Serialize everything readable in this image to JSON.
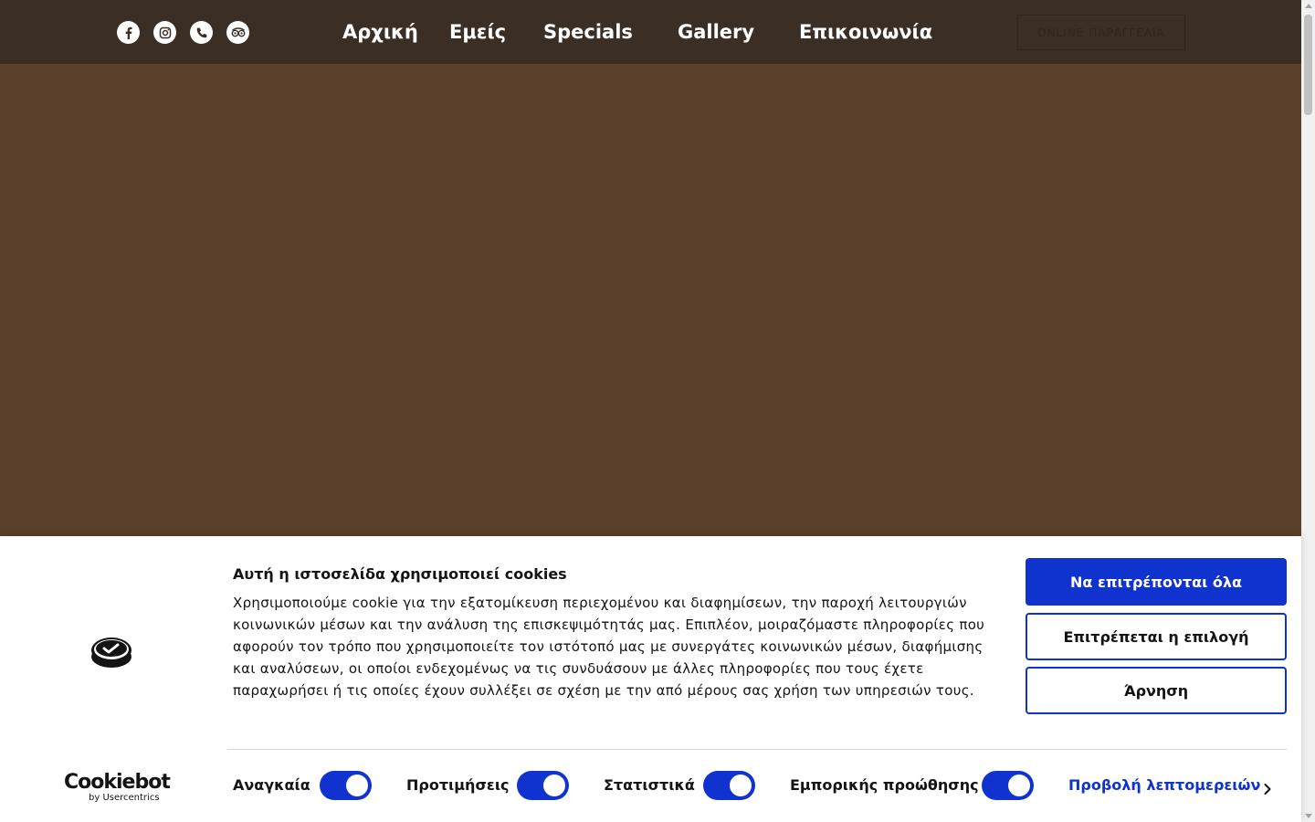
{
  "nav": {
    "social_icons": [
      "facebook-icon",
      "instagram-icon",
      "phone-icon",
      "tripadvisor-icon"
    ],
    "links": [
      "Αρχική",
      "Εμείς",
      "Specials",
      "Gallery",
      "Επικοινωνία"
    ],
    "online_order_label": "ONLINE ΠΑΡΑΓΓΕΛΙΑ"
  },
  "cookie": {
    "title": "Αυτή η ιστοσελίδα χρησιμοποιεί cookies",
    "body": "Χρησιμοποιούμε cookie για την εξατομίκευση περιεχομένου και διαφημίσεων, την παροχή λειτουργιών κοινωνικών μέσων και την ανάλυση της επισκεψιμότητάς μας. Επιπλέον, μοιραζόμαστε πληροφορίες που αφορούν τον τρόπο που χρησιμοποιείτε τον ιστότοπό μας με συνεργάτες κοινωνικών μέσων, διαφήμισης και αναλύσεων, οι οποίοι ενδεχομένως να τις συνδυάσουν με άλλες πληροφορίες που τους έχετε παραχωρήσει ή τις οποίες έχουν συλλέξει σε σχέση με την από μέρους σας χρήση των υπηρεσιών τους.",
    "allow_all": "Να επιτρέπονται όλα",
    "allow_selection": "Επιτρέπεται η επιλογή",
    "deny": "Άρνηση",
    "toggles": [
      {
        "label": "Αναγκαία",
        "on": true
      },
      {
        "label": "Προτιμήσεις",
        "on": true
      },
      {
        "label": "Στατιστικά",
        "on": true
      },
      {
        "label": "Εμπορικής προώθησης",
        "on": true
      }
    ],
    "details_link": "Προβολή λεπτομερειών",
    "brand_name": "Cookiebot",
    "brand_sub": "by Usercentrics"
  },
  "colors": {
    "nav_bg": "#3b2f25",
    "hero_bg": "#5b412c",
    "accent": "#1032cf"
  }
}
